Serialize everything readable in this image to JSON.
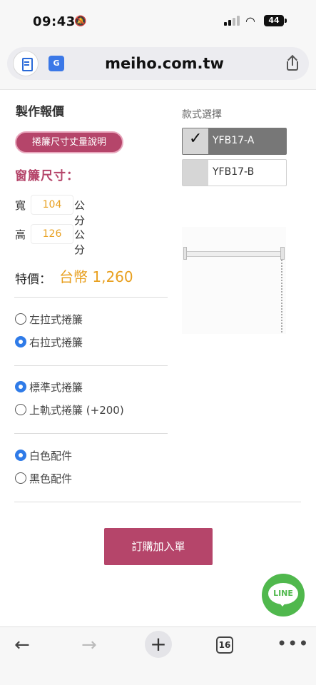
{
  "status_bar": {
    "time": "09:43",
    "battery": "44"
  },
  "browser": {
    "url": "meiho.com.tw"
  },
  "page": {
    "title": "製作報價",
    "guide_button": "捲簾尺寸丈量說明",
    "size_heading": "窗簾尺寸：",
    "width": {
      "label": "寬",
      "value": "104",
      "unit": "公分"
    },
    "height": {
      "label": "高",
      "value": "126",
      "unit": "公分"
    },
    "price": {
      "label": "特價：",
      "value": "台幣 1,260"
    },
    "pull_direction": [
      {
        "label": "左拉式捲簾",
        "checked": false
      },
      {
        "label": "右拉式捲簾",
        "checked": true
      }
    ],
    "mount_type": [
      {
        "label": "標準式捲簾",
        "checked": true
      },
      {
        "label": "上軌式捲簾 (+200)",
        "checked": false
      }
    ],
    "accessory_color": [
      {
        "label": "白色配件",
        "checked": true
      },
      {
        "label": "黑色配件",
        "checked": false
      }
    ],
    "order_button": "訂購加入單"
  },
  "style_select": {
    "heading": "款式選擇",
    "options": [
      {
        "label": "YFB17-A",
        "selected": true
      },
      {
        "label": "YFB17-B",
        "selected": false
      }
    ]
  },
  "line_button": {
    "label": "LINE",
    "color": "#50b84d"
  },
  "toolbar": {
    "tab_count": "16"
  },
  "colors": {
    "accent": "#b5456a",
    "price": "#e8a020",
    "radio": "#2f7be8"
  }
}
